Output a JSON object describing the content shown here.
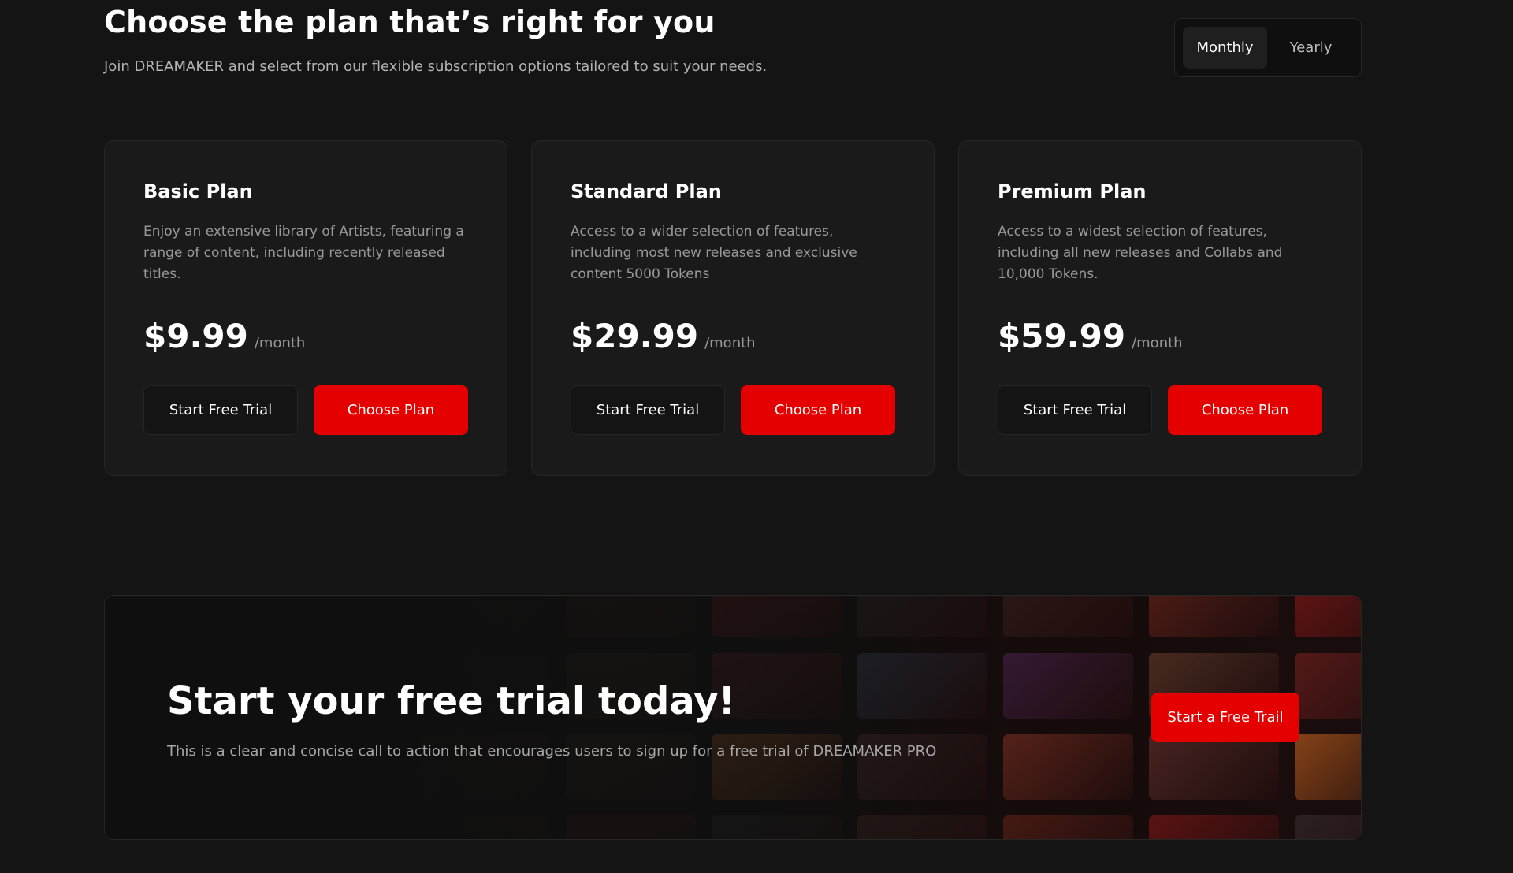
{
  "header": {
    "title": "Choose the plan that’s right for you",
    "subtitle": "Join DREAMAKER and select from our flexible subscription options tailored to suit your needs."
  },
  "billing_toggle": {
    "options": [
      "Monthly",
      "Yearly"
    ],
    "selected": "Monthly"
  },
  "plans": [
    {
      "name": "Basic Plan",
      "description": "Enjoy an extensive library of Artists, featuring a range of content, including recently released titles.",
      "price": "$9.99",
      "period": "/month",
      "trial_label": "Start Free Trial",
      "choose_label": "Choose Plan"
    },
    {
      "name": "Standard Plan",
      "description": "Access to a wider selection of features, including most new releases and exclusive content 5000 Tokens",
      "price": "$29.99",
      "period": "/month",
      "trial_label": "Start Free Trial",
      "choose_label": "Choose Plan"
    },
    {
      "name": "Premium Plan",
      "description": "Access to a widest selection of features, including all new releases and Collabs and 10,000 Tokens.",
      "price": "$59.99",
      "period": "/month",
      "trial_label": "Start Free Trial",
      "choose_label": "Choose Plan"
    }
  ],
  "cta": {
    "title": "Start your free trial today!",
    "description": "This is a clear and concise call to action that encourages users to sign up for a free trial of DREAMAKER PRO",
    "button_label": "Start a Free Trail"
  },
  "colors": {
    "background": "#141414",
    "card": "#1a1a1a",
    "accent": "#e50000",
    "border": "#262626"
  }
}
